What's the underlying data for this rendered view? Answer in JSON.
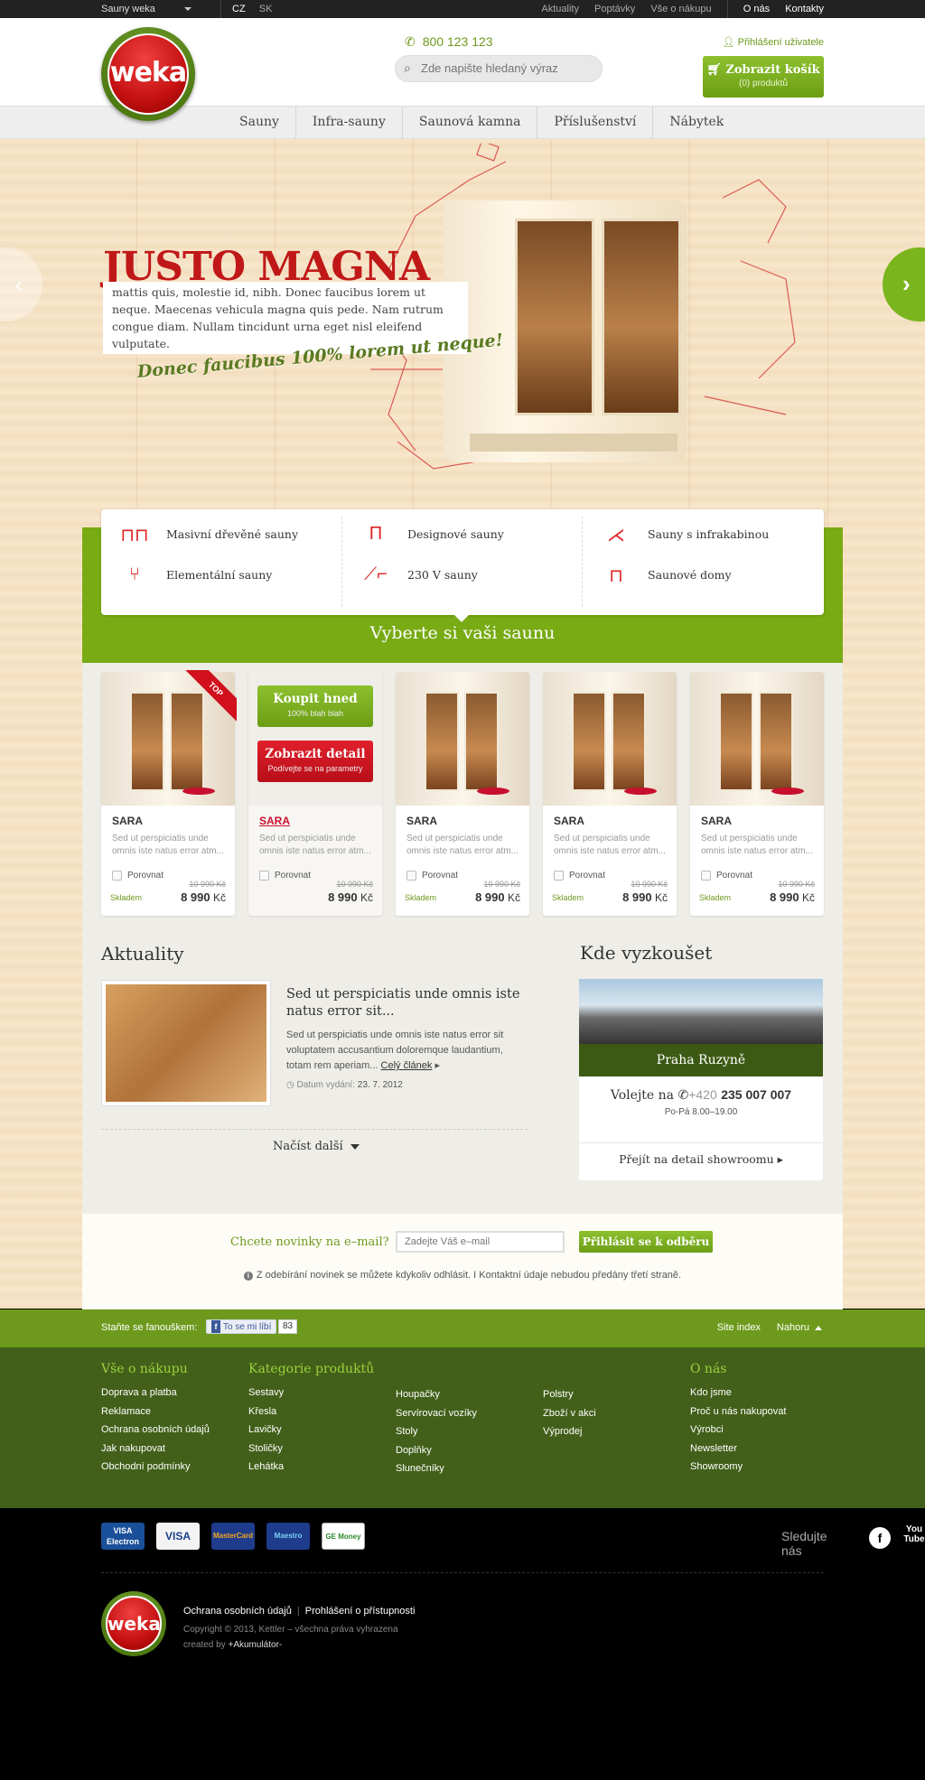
{
  "topbar": {
    "site": "Sauny weka",
    "langs": [
      "CZ",
      "SK"
    ],
    "links": [
      "Aktuality",
      "Poptávky",
      "Vše o nákupu"
    ],
    "links2": [
      "O nás",
      "Kontakty"
    ]
  },
  "header": {
    "logo": "weka",
    "phone": "800 123 123",
    "search_placeholder": "Zde napište hledaný výraz",
    "login": "Přihlášení uživatele",
    "cart_label": "Zobrazit košík",
    "cart_count": "(0) produktů"
  },
  "nav": [
    "Sauny",
    "Infra-sauny",
    "Saunová kamna",
    "Příslušenství",
    "Nábytek"
  ],
  "hero": {
    "title": "JUSTO MAGNA",
    "text": "mattis quis, molestie id, nibh. Donec faucibus lorem ut neque. Maecenas vehicula magna quis pede. Nam rutrum congue diam. Nullam tincidunt urna eget nisl eleifend vulputate.",
    "slogan": "Donec faucibus 100% lorem ut neque!"
  },
  "categories": [
    {
      "label": "Masivní dřevěné sauny",
      "icon": "table-chairs-icon"
    },
    {
      "label": "Elementální sauny",
      "icon": "chair-icon"
    },
    {
      "label": "Designové sauny",
      "icon": "stool-icon"
    },
    {
      "label": "230 V sauny",
      "icon": "lounger-icon"
    },
    {
      "label": "Sauny s infrakabinou",
      "icon": "deckchair-icon"
    },
    {
      "label": "Saunové domy",
      "icon": "table-icon"
    }
  ],
  "choose_title": "Vyberte si vaši saunu",
  "products": [
    {
      "name": "SARA",
      "desc": "Sed ut perspiciatis unde omnis iste natus error atm...",
      "compare": "Porovnat",
      "old_price": "10 990 Kč",
      "price": "8 990",
      "currency": "Kč",
      "stock": "Skladem",
      "badge": "TOP"
    },
    {
      "name": "SARA",
      "desc": "Sed ut perspiciatis unde omnis iste natus error atm...",
      "compare": "Porovnat",
      "old_price": "10 990 Kč",
      "price": "8 990",
      "currency": "Kč",
      "stock": "",
      "buy": "Koupit hned",
      "buy_sub": "100% blah blah",
      "detail": "Zobrazit detail",
      "detail_sub": "Podívejte se na parametry"
    },
    {
      "name": "SARA",
      "desc": "Sed ut perspiciatis unde omnis iste natus error atm...",
      "compare": "Porovnat",
      "old_price": "10 990 Kč",
      "price": "8 990",
      "currency": "Kč",
      "stock": "Skladem"
    },
    {
      "name": "SARA",
      "desc": "Sed ut perspiciatis unde omnis iste natus error atm...",
      "compare": "Porovnat",
      "old_price": "10 990 Kč",
      "price": "8 990",
      "currency": "Kč",
      "stock": "Skladem"
    },
    {
      "name": "SARA",
      "desc": "Sed ut perspiciatis unde omnis iste natus error atm...",
      "compare": "Porovnat",
      "old_price": "10 990 Kč",
      "price": "8 990",
      "currency": "Kč",
      "stock": "Skladem"
    }
  ],
  "news": {
    "title": "Aktuality",
    "headline": "Sed ut perspiciatis unde omnis iste natus error sit...",
    "text": "Sed ut perspiciatis unde omnis iste natus error sit voluptatem accusantium doloremque laudantium, totam rem aperiam...",
    "more": "Celý článek",
    "date_label": "Datum vydání:",
    "date": "23. 7. 2012",
    "load_more": "Načíst další"
  },
  "showroom": {
    "title": "Kde vyzkoušet",
    "city": "Praha Ruzyně",
    "call": "Volejte na",
    "prefix": "+420",
    "phone": "235 007 007",
    "hours": "Po-Pá 8.00–19.00",
    "detail": "Přejít na detail showroomu"
  },
  "newsletter": {
    "label": "Chcete novinky na e–mail?",
    "placeholder": "Zadejte Váš e–mail",
    "button": "Přihlásit se k odběru",
    "note": "Z odebírání novinek se můžete kdykoliv odhlásit. I Kontaktní údaje nebudou předány třetí straně."
  },
  "likebar": {
    "fan": "Staňte se fanouškem:",
    "like": "To se mi líbí",
    "count": "83",
    "sitemap": "Site index",
    "up": "Nahoru"
  },
  "footer": {
    "col1": {
      "title": "Vše o nákupu",
      "items": [
        "Doprava a platba",
        "Reklamace",
        "Ochrana osobních údajů",
        "Jak nakupovat",
        "Obchodní podmínky"
      ]
    },
    "col2": {
      "title": "Kategorie produktů",
      "items": [
        "Sestavy",
        "Křesla",
        "Lavičky",
        "Stoličky",
        "Lehátka"
      ]
    },
    "col3": {
      "items": [
        "Houpačky",
        "Servírovací vozíky",
        "Stoly",
        "Doplňky",
        "Slunečníky"
      ]
    },
    "col4": {
      "items": [
        "Polstry",
        "Zboží v akci",
        "Výprodej"
      ]
    },
    "col5": {
      "title": "O nás",
      "items": [
        "Kdo jsme",
        "Proč u nás nakupovat",
        "Výrobci",
        "Newsletter",
        "Showroomy"
      ]
    }
  },
  "bottom": {
    "payments": [
      "VISA Electron",
      "VISA",
      "MasterCard",
      "Maestro",
      "GE Money"
    ],
    "follow": "Sledujte nás",
    "facebook": "f",
    "youtube": "You Tube",
    "links": [
      "Ochrana osobních údajů",
      "Prohlášení o přístupnosti"
    ],
    "copyright": "Copyright © 2013, Kettler – všechna práva vyhrazena",
    "created": "created by",
    "author": "+Akumulátor-"
  }
}
